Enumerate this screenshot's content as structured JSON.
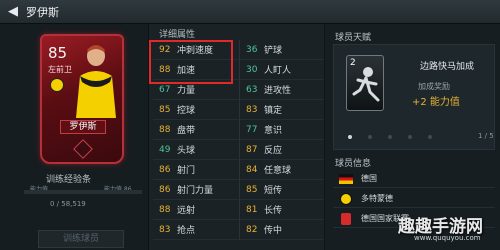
{
  "header": {
    "back_icon": "back-arrow-icon",
    "title": "罗伊斯"
  },
  "card": {
    "rating": "85",
    "position": "左前卫",
    "name": "罗伊斯",
    "accent": "#b6303a"
  },
  "training": {
    "label": "训练经验条",
    "left_caption": "能力值",
    "right_caption": "能力值 86",
    "progress": 0,
    "count": "0 / 58,519",
    "button": "训练球员"
  },
  "attributes": {
    "header": "详细属性",
    "left": [
      {
        "value": "92",
        "name": "冲刺速度",
        "color": "yellow"
      },
      {
        "value": "88",
        "name": "加速",
        "color": "yellow"
      },
      {
        "value": "67",
        "name": "力量",
        "color": "green"
      },
      {
        "value": "85",
        "name": "控球",
        "color": "yellow"
      },
      {
        "value": "88",
        "name": "盘带",
        "color": "yellow"
      },
      {
        "value": "49",
        "name": "头球",
        "color": "green"
      },
      {
        "value": "86",
        "name": "射门",
        "color": "yellow"
      },
      {
        "value": "86",
        "name": "射门力量",
        "color": "yellow"
      },
      {
        "value": "88",
        "name": "远射",
        "color": "yellow"
      },
      {
        "value": "83",
        "name": "抢点",
        "color": "yellow"
      }
    ],
    "right": [
      {
        "value": "36",
        "name": "铲球",
        "color": "green"
      },
      {
        "value": "30",
        "name": "人盯人",
        "color": "green"
      },
      {
        "value": "63",
        "name": "进攻性",
        "color": "green"
      },
      {
        "value": "83",
        "name": "镇定",
        "color": "yellow"
      },
      {
        "value": "77",
        "name": "意识",
        "color": "green"
      },
      {
        "value": "87",
        "name": "反应",
        "color": "yellow"
      },
      {
        "value": "84",
        "name": "任意球",
        "color": "yellow"
      },
      {
        "value": "85",
        "name": "短传",
        "color": "yellow"
      },
      {
        "value": "81",
        "name": "长传",
        "color": "yellow"
      },
      {
        "value": "82",
        "name": "传中",
        "color": "yellow"
      }
    ]
  },
  "talent": {
    "title": "球员天赋",
    "level": "2",
    "name": "边路快马加成",
    "bonus_label": "加成奖励",
    "bonus": "+2 能力值",
    "page": "1 / 5"
  },
  "info": {
    "title": "球员信息",
    "nation": "德国",
    "club": "多特蒙德",
    "league": "德国国家联赛"
  },
  "watermark": {
    "text": "趣趣手游网",
    "url": "www.ququyou.com"
  }
}
